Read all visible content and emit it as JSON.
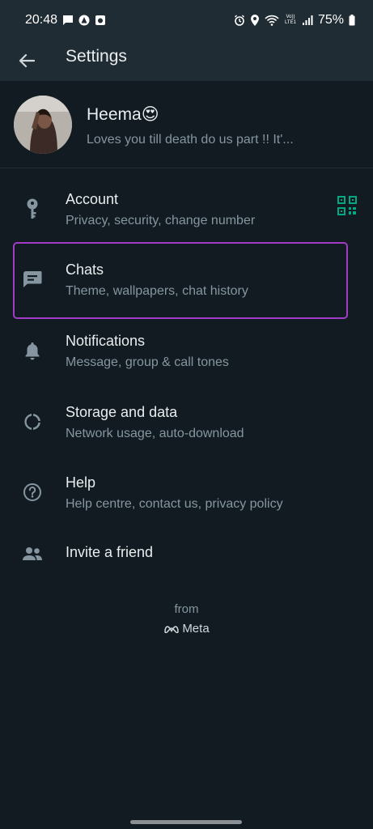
{
  "status_bar": {
    "time": "20:48",
    "battery": "75%",
    "network": "Vo)) LTE1"
  },
  "app_bar": {
    "title": "Settings"
  },
  "profile": {
    "name": "Heema😍",
    "about": "Loves you till death do us part !! It'..."
  },
  "items": [
    {
      "title": "Account",
      "subtitle": "Privacy, security, change number",
      "icon": "key-icon"
    },
    {
      "title": "Chats",
      "subtitle": "Theme, wallpapers, chat history",
      "icon": "chat-icon"
    },
    {
      "title": "Notifications",
      "subtitle": "Message, group & call tones",
      "icon": "bell-icon"
    },
    {
      "title": "Storage and data",
      "subtitle": "Network usage, auto-download",
      "icon": "storage-icon"
    },
    {
      "title": "Help",
      "subtitle": "Help centre, contact us, privacy policy",
      "icon": "help-icon"
    },
    {
      "title": "Invite a friend",
      "subtitle": "",
      "icon": "people-icon"
    }
  ],
  "footer": {
    "from": "from",
    "brand": "Meta"
  },
  "colors": {
    "background": "#111b21",
    "app_bar": "#202c33",
    "accent": "#00a884",
    "highlight": "#a23cc8"
  }
}
